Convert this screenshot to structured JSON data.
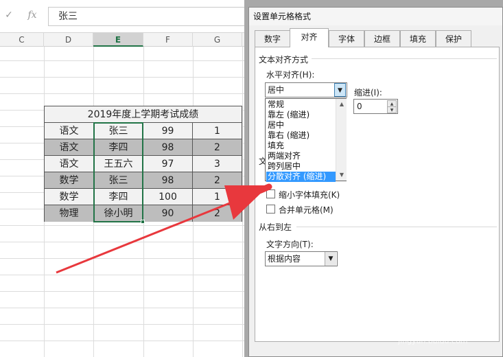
{
  "formula_bar": {
    "check_icon": "✓",
    "fx_label": "fx",
    "content": "张三"
  },
  "columns": [
    "C",
    "D",
    "E",
    "F",
    "G"
  ],
  "selected_column": "E",
  "table": {
    "title": "2019年度上学期考试成绩",
    "rows": [
      {
        "subject": "语文",
        "name": "张三",
        "score": "99",
        "rank": "1",
        "shade": "light"
      },
      {
        "subject": "语文",
        "name": "李四",
        "score": "98",
        "rank": "2",
        "shade": "dark"
      },
      {
        "subject": "语文",
        "name": "王五六",
        "score": "97",
        "rank": "3",
        "shade": "light"
      },
      {
        "subject": "数学",
        "name": "张三",
        "score": "98",
        "rank": "2",
        "shade": "dark"
      },
      {
        "subject": "数学",
        "name": "李四",
        "score": "100",
        "rank": "1",
        "shade": "light"
      },
      {
        "subject": "物理",
        "name": "徐小明",
        "score": "90",
        "rank": "2",
        "shade": "dark"
      }
    ]
  },
  "dialog": {
    "title": "设置单元格格式",
    "tabs": [
      "数字",
      "对齐",
      "字体",
      "边框",
      "填充",
      "保护"
    ],
    "active_tab": "对齐",
    "text_align_group": "文本对齐方式",
    "horizontal_label": "水平对齐(H):",
    "horizontal_value": "居中",
    "indent_label": "缩进(I):",
    "indent_value": "0",
    "dropdown_options": [
      "常规",
      "靠左 (缩进)",
      "居中",
      "靠右 (缩进)",
      "填充",
      "两端对齐",
      "跨列居中",
      "分散对齐 (缩进)"
    ],
    "highlighted_option": "分散对齐 (缩进)",
    "text_control_partial": "文",
    "shrink_label": "缩小字体填充(K)",
    "merge_label": "合并单元格(M)",
    "rtl_group": "从右到左",
    "direction_label": "文字方向(T):",
    "direction_value": "根据内容"
  },
  "watermark": {
    "brand": "Baidu经验",
    "url": "jingyan.baidu.com"
  },
  "colors": {
    "selection": "#217346",
    "highlight": "#3399ff",
    "arrow": "#e8383d"
  }
}
